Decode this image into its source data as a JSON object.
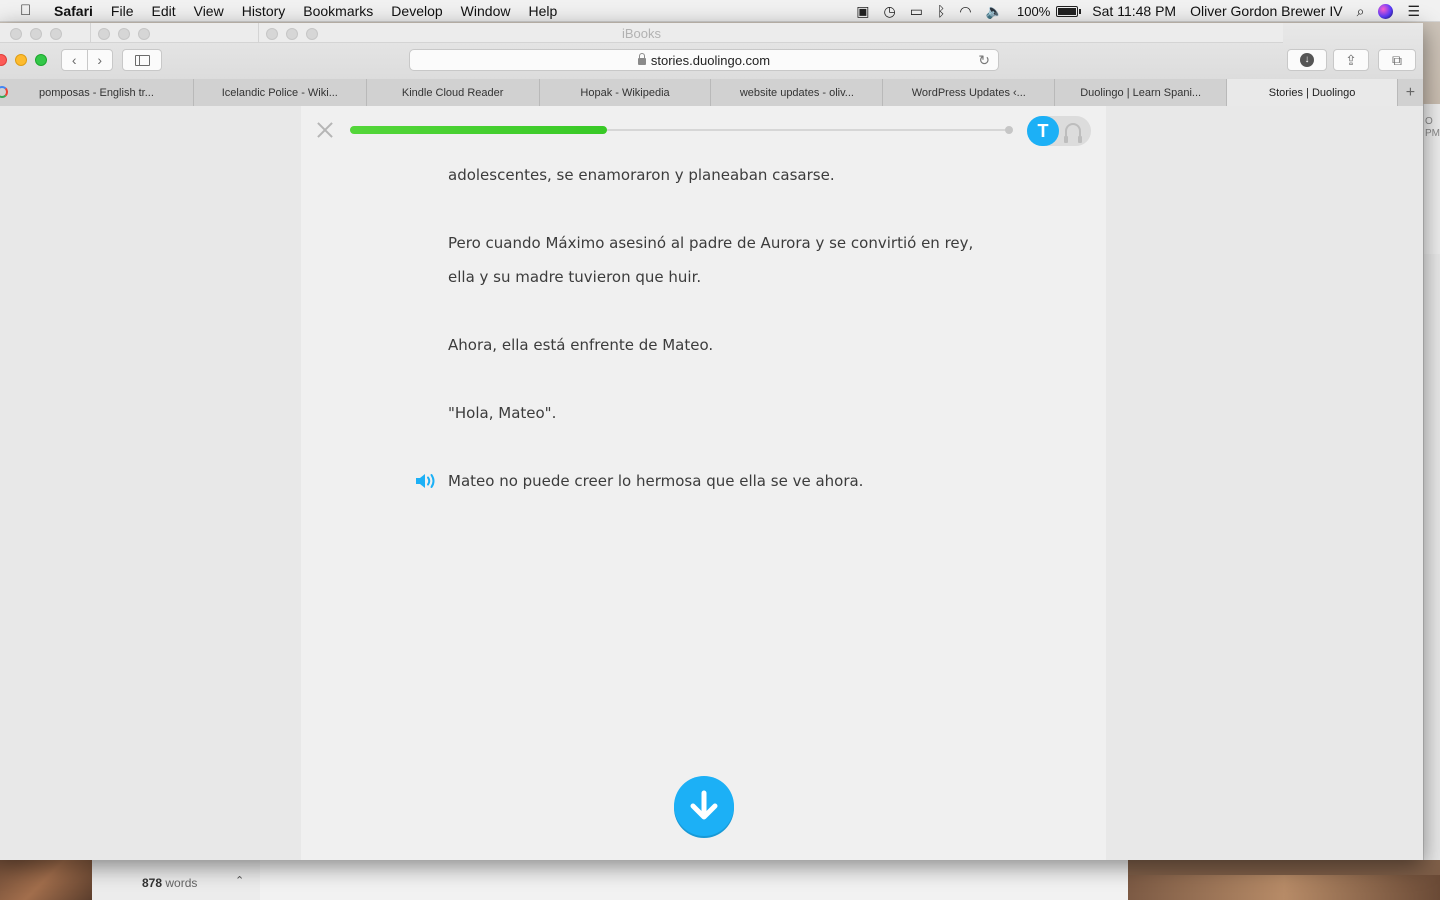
{
  "menubar": {
    "app_name": "Safari",
    "items": [
      "File",
      "Edit",
      "View",
      "History",
      "Bookmarks",
      "Develop",
      "Window",
      "Help"
    ],
    "battery": "100%",
    "clock": "Sat 11:48 PM",
    "user": "Oliver Gordon Brewer IV"
  },
  "background_window": {
    "title": "iBooks",
    "word_count": "878",
    "word_label": "words",
    "side_text": "O PM"
  },
  "browser": {
    "url": "stories.duolingo.com",
    "tabs": [
      {
        "label": "pomposas - English tr..."
      },
      {
        "label": "Icelandic Police - Wiki..."
      },
      {
        "label": "Kindle Cloud Reader"
      },
      {
        "label": "Hopak - Wikipedia"
      },
      {
        "label": "website updates - oliv..."
      },
      {
        "label": "WordPress Updates ‹..."
      },
      {
        "label": "Duolingo | Learn Spani..."
      },
      {
        "label": "Stories | Duolingo",
        "active": true
      }
    ]
  },
  "story": {
    "progress": 0.39,
    "mode_text_label": "T",
    "lines": [
      "adolescentes, se enamoraron y planeaban casarse.",
      "Pero cuando Máximo asesinó al padre de Aurora y se convirtió en rey,",
      "ella y su madre tuvieron que huir.",
      "Ahora, ella está enfrente de Mateo.",
      "\"Hola, Mateo\".",
      "Mateo no puede creer lo hermosa que ella se ve ahora."
    ],
    "accent_color": "#1cb0f6",
    "progress_color": "#38c926"
  }
}
